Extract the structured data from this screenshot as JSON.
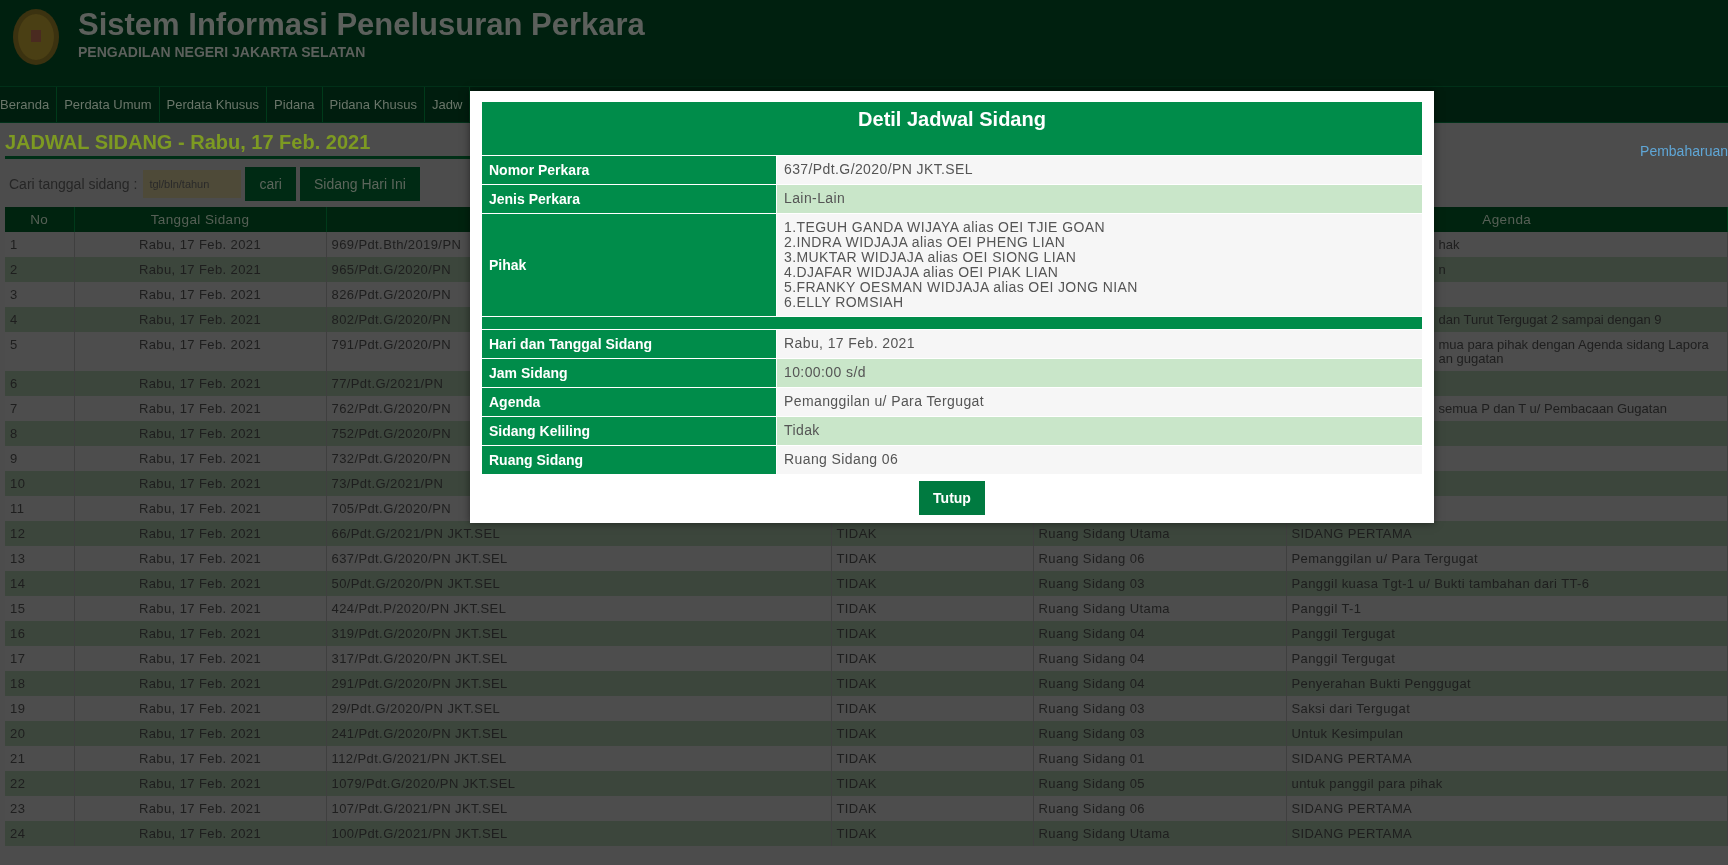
{
  "header": {
    "title": "Sistem Informasi Penelusuran Perkara",
    "subtitle": "PENGADILAN NEGERI JAKARTA SELATAN"
  },
  "nav": [
    {
      "label": "Beranda"
    },
    {
      "label": "Perdata Umum"
    },
    {
      "label": "Perdata Khusus"
    },
    {
      "label": "Pidana"
    },
    {
      "label": "Pidana Khusus"
    },
    {
      "label": "Jadw"
    }
  ],
  "page_title": "JADWAL SIDANG - Rabu, 17 Feb. 2021",
  "update_link": "Pembaharuan",
  "search": {
    "label": "Cari tanggal sidang :",
    "placeholder": "tgl/bln/tahun",
    "buttons": [
      "cari",
      "Sidang Hari Ini"
    ]
  },
  "table": {
    "columns": {
      "no": "No",
      "date": "Tanggal Sidang",
      "agenda": "Agenda"
    },
    "rows": [
      {
        "no": "1",
        "date": "Rabu, 17 Feb. 2021",
        "column_3": "969/Pdt.Bth/2019/PN",
        "agenda": "hak"
      },
      {
        "no": "2",
        "date": "Rabu, 17 Feb. 2021",
        "column_3": "965/Pdt.G/2020/PN",
        "agenda": "n"
      },
      {
        "no": "3",
        "date": "Rabu, 17 Feb. 2021",
        "column_3": "826/Pdt.G/2020/PN"
      },
      {
        "no": "4",
        "date": "Rabu, 17 Feb. 2021",
        "column_3": "802/Pdt.G/2020/PN",
        "agenda": "dan Turut Tergugat 2 sampai dengan 9"
      },
      {
        "no": "5",
        "date": "Rabu, 17 Feb. 2021",
        "column_3": "791/Pdt.G/2020/PN",
        "agenda": "mua para pihak dengan Agenda sidang Lapora\nan gugatan"
      },
      {
        "no": "6",
        "date": "Rabu, 17 Feb. 2021",
        "column_3": "77/Pdt.G/2021/PN"
      },
      {
        "no": "7",
        "date": "Rabu, 17 Feb. 2021",
        "column_3": "762/Pdt.G/2020/PN",
        "agenda": "semua P dan T u/ Pembacaan Gugatan"
      },
      {
        "no": "8",
        "date": "Rabu, 17 Feb. 2021",
        "column_3": "752/Pdt.G/2020/PN"
      },
      {
        "no": "9",
        "date": "Rabu, 17 Feb. 2021",
        "column_3": "732/Pdt.G/2020/PN"
      },
      {
        "no": "10",
        "date": "Rabu, 17 Feb. 2021",
        "column_3": "73/Pdt.G/2021/PN"
      },
      {
        "no": "11",
        "date": "Rabu, 17 Feb. 2021",
        "column_3": "705/Pdt.G/2020/PN"
      },
      {
        "no": "12",
        "date": "Rabu, 17 Feb. 2021",
        "column_3": "66/Pdt.G/2021/PN JKT.SEL",
        "column_4": "TIDAK",
        "column_5": "Ruang Sidang Utama",
        "agenda": "SIDANG PERTAMA"
      },
      {
        "no": "13",
        "date": "Rabu, 17 Feb. 2021",
        "column_3": "637/Pdt.G/2020/PN JKT.SEL",
        "column_4": "TIDAK",
        "column_5": "Ruang Sidang 06",
        "agenda": "Pemanggilan u/ Para Tergugat"
      },
      {
        "no": "14",
        "date": "Rabu, 17 Feb. 2021",
        "column_3": "50/Pdt.G/2020/PN JKT.SEL",
        "column_4": "TIDAK",
        "column_5": "Ruang Sidang 03",
        "agenda": "Panggil kuasa Tgt-1 u/ Bukti tambahan dari TT-6"
      },
      {
        "no": "15",
        "date": "Rabu, 17 Feb. 2021",
        "column_3": "424/Pdt.P/2020/PN JKT.SEL",
        "column_4": "TIDAK",
        "column_5": "Ruang Sidang Utama",
        "agenda": "Panggil T-1"
      },
      {
        "no": "16",
        "date": "Rabu, 17 Feb. 2021",
        "column_3": "319/Pdt.G/2020/PN JKT.SEL",
        "column_4": "TIDAK",
        "column_5": "Ruang Sidang 04",
        "agenda": "Panggil Tergugat"
      },
      {
        "no": "17",
        "date": "Rabu, 17 Feb. 2021",
        "column_3": "317/Pdt.G/2020/PN JKT.SEL",
        "column_4": "TIDAK",
        "column_5": "Ruang Sidang 04",
        "agenda": "Panggil Tergugat"
      },
      {
        "no": "18",
        "date": "Rabu, 17 Feb. 2021",
        "column_3": "291/Pdt.G/2020/PN JKT.SEL",
        "column_4": "TIDAK",
        "column_5": "Ruang Sidang 04",
        "agenda": "Penyerahan Bukti Penggugat"
      },
      {
        "no": "19",
        "date": "Rabu, 17 Feb. 2021",
        "column_3": "29/Pdt.G/2020/PN JKT.SEL",
        "column_4": "TIDAK",
        "column_5": "Ruang Sidang 03",
        "agenda": "Saksi dari Tergugat"
      },
      {
        "no": "20",
        "date": "Rabu, 17 Feb. 2021",
        "column_3": "241/Pdt.G/2020/PN JKT.SEL",
        "column_4": "TIDAK",
        "column_5": "Ruang Sidang 03",
        "agenda": "Untuk Kesimpulan"
      },
      {
        "no": "21",
        "date": "Rabu, 17 Feb. 2021",
        "column_3": "112/Pdt.G/2021/PN JKT.SEL",
        "column_4": "TIDAK",
        "column_5": "Ruang Sidang 01",
        "agenda": "SIDANG PERTAMA"
      },
      {
        "no": "22",
        "date": "Rabu, 17 Feb. 2021",
        "column_3": "1079/Pdt.G/2020/PN JKT.SEL",
        "column_4": "TIDAK",
        "column_5": "Ruang Sidang 05",
        "agenda": "untuk panggil para pihak"
      },
      {
        "no": "23",
        "date": "Rabu, 17 Feb. 2021",
        "column_3": "107/Pdt.G/2021/PN JKT.SEL",
        "column_4": "TIDAK",
        "column_5": "Ruang Sidang 06",
        "agenda": "SIDANG PERTAMA"
      },
      {
        "no": "24",
        "date": "Rabu, 17 Feb. 2021",
        "column_3": "100/Pdt.G/2021/PN JKT.SEL",
        "column_4": "TIDAK",
        "column_5": "Ruang Sidang Utama",
        "agenda": "SIDANG PERTAMA"
      }
    ]
  },
  "dialog": {
    "title": "Detil Jadwal Sidang",
    "fields": [
      {
        "kind": "text",
        "label": "Nomor Perkara",
        "value": "637/Pdt.G/2020/PN JKT.SEL"
      },
      {
        "kind": "text",
        "label": "Jenis Perkara",
        "value": "Lain-Lain"
      },
      {
        "kind": "list",
        "label": "Pihak",
        "values": [
          "1.TEGUH GANDA WIJAYA alias OEI TJIE GOAN",
          "2.INDRA WIDJAJA alias OEI PHENG LIAN",
          "3.MUKTAR WIDJAJA alias OEI SIONG LIAN",
          "4.DJAFAR WIDJAJA alias OEI PIAK LIAN",
          "5.FRANKY OESMAN WIDJAJA alias OEI JONG NIAN",
          "6.ELLY ROMSIAH"
        ]
      },
      {
        "kind": "separator"
      },
      {
        "kind": "text",
        "label": "Hari dan Tanggal Sidang",
        "value": "Rabu, 17 Feb. 2021"
      },
      {
        "kind": "text",
        "label": "Jam Sidang",
        "value": "10:00:00 s/d"
      },
      {
        "kind": "text",
        "label": "Agenda",
        "value": "Pemanggilan u/ Para Tergugat"
      },
      {
        "kind": "text",
        "label": "Sidang Keliling",
        "value": "Tidak"
      },
      {
        "kind": "text",
        "label": "Ruang Sidang",
        "value": "Ruang Sidang 06"
      }
    ],
    "close_button": "Tutup"
  }
}
